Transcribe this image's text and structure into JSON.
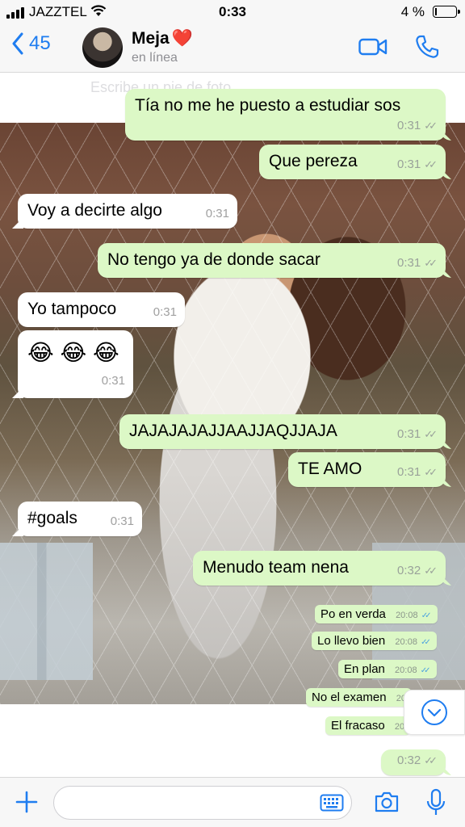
{
  "status_bar": {
    "carrier": "JAZZTEL",
    "time": "0:33",
    "battery": "4 %"
  },
  "header": {
    "back_count": "45",
    "contact_name": "Meja",
    "contact_emoji": "❤️",
    "contact_status": "en línea"
  },
  "photo_caption": "Escribe un pie de foto",
  "messages": [
    {
      "text": "Tía no me he puesto a estudiar sos",
      "time": "0:31",
      "ticks": "✓✓"
    },
    {
      "text": "Que pereza",
      "time": "0:31",
      "ticks": "✓✓"
    },
    {
      "text": "Voy a decirte algo",
      "time": "0:31"
    },
    {
      "text": "No tengo ya de donde sacar",
      "time": "0:31",
      "ticks": "✓✓"
    },
    {
      "text": "Yo tampoco",
      "time": "0:31"
    },
    {
      "text": "😂 😂 😂",
      "time": "0:31"
    },
    {
      "text": "JAJAJAJAJJAAJJAQJJAJA",
      "time": "0:31",
      "ticks": "✓✓"
    },
    {
      "text": "TE AMO",
      "time": "0:31",
      "ticks": "✓✓"
    },
    {
      "text": "#goals",
      "time": "0:31"
    },
    {
      "text": "Menudo team nena",
      "time": "0:32",
      "ticks": "✓✓"
    }
  ],
  "embedded_messages": [
    {
      "text": "Po en verda",
      "time": "20:08",
      "ticks": "✓✓"
    },
    {
      "text": "Lo llevo bien",
      "time": "20:08",
      "ticks": "✓✓"
    },
    {
      "text": "En plan",
      "time": "20:08",
      "ticks": "✓✓"
    },
    {
      "text": "No el examen",
      "time": "20"
    },
    {
      "text": "El fracaso",
      "time": "20"
    }
  ],
  "last_message": {
    "time": "0:32",
    "ticks": "✓✓"
  },
  "input": {
    "placeholder": ""
  },
  "colors": {
    "accent": "#1f7df0",
    "outgoing_bubble": "#dcf8c6",
    "incoming_bubble": "#ffffff"
  },
  "icons": [
    "back-chevron-icon",
    "video-call-icon",
    "phone-icon",
    "plus-icon",
    "sticker-icon",
    "camera-icon",
    "microphone-icon",
    "chevron-down-icon"
  ]
}
